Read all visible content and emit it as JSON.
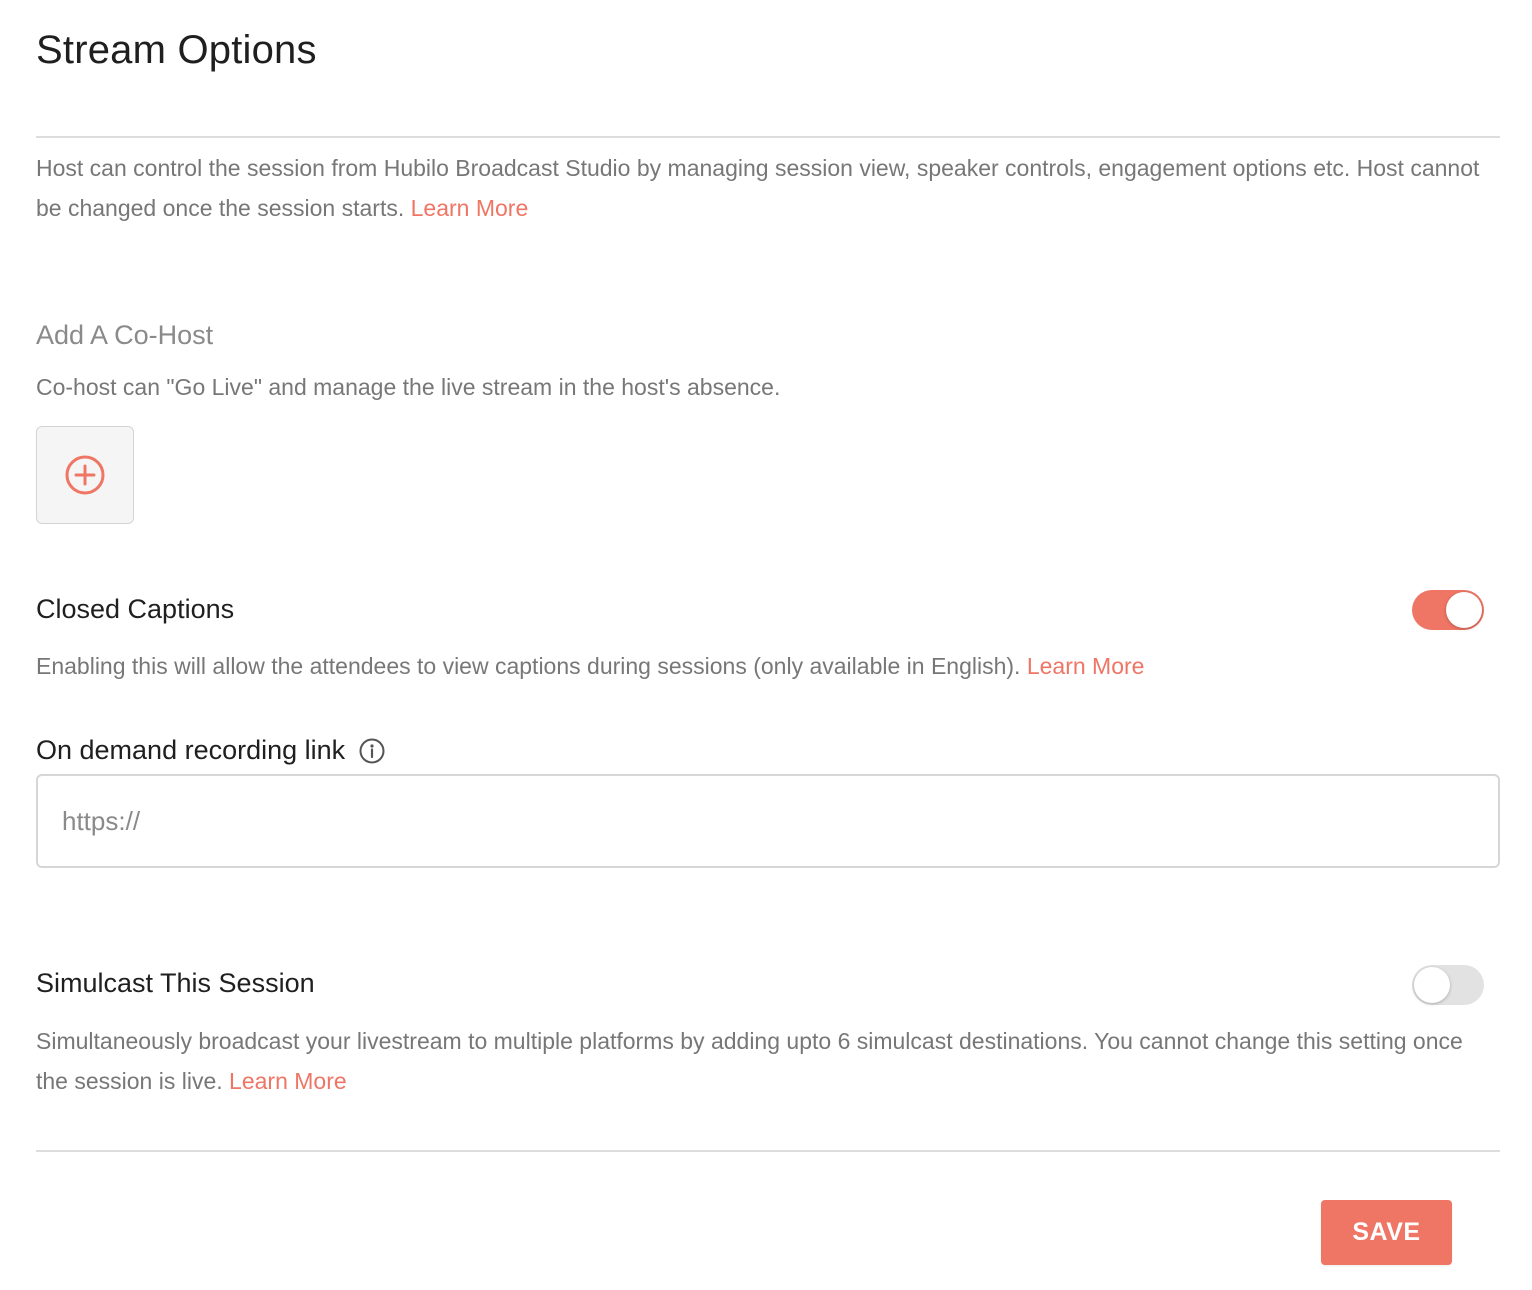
{
  "page": {
    "title": "Stream Options"
  },
  "host": {
    "description": "Host can control the session from Hubilo Broadcast Studio by managing session view, speaker controls, engagement options etc. Host cannot be changed once the session starts.",
    "learn_more": "Learn More"
  },
  "cohost": {
    "title": "Add A Co-Host",
    "description": "Co-host can \"Go Live\" and manage the live stream in the host's absence.",
    "add_icon": "plus-circle-icon"
  },
  "closed_captions": {
    "title": "Closed Captions",
    "enabled": true,
    "description": "Enabling this will allow the attendees to view captions during sessions (only available in English).",
    "learn_more": "Learn More"
  },
  "recording_link": {
    "title": "On demand recording link",
    "info_icon": "info-icon",
    "value": "",
    "placeholder": "https://"
  },
  "simulcast": {
    "title": "Simulcast This Session",
    "enabled": false,
    "description": "Simultaneously broadcast your livestream to multiple platforms by adding upto 6 simulcast destinations. You cannot change this setting once the session is live.",
    "learn_more": "Learn More"
  },
  "footer": {
    "save_label": "SAVE"
  },
  "colors": {
    "accent": "#ef7565",
    "muted_text": "#777777",
    "toggle_off": "#e2e2e2"
  }
}
